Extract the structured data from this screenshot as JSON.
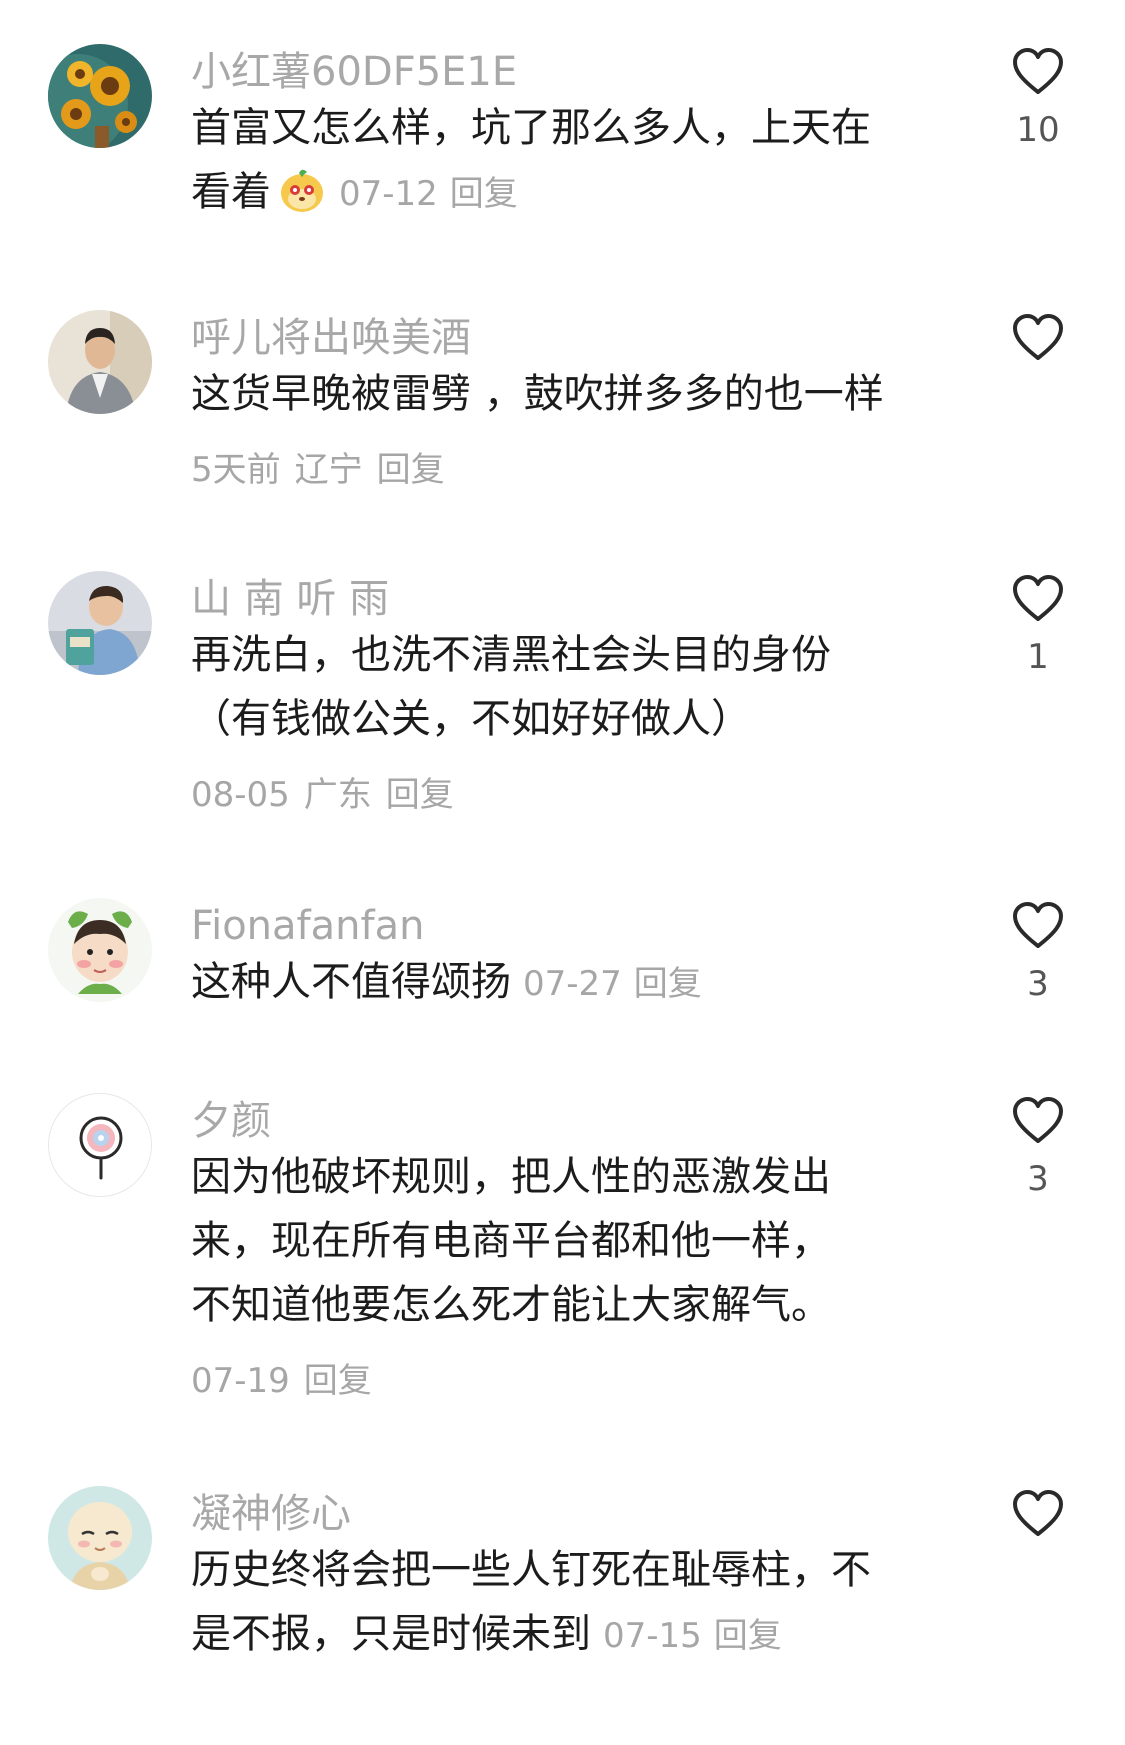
{
  "comments": [
    {
      "username": "小红薯60DF5E1E",
      "text": "首富又怎么样，坑了那么多人，上天在看着",
      "has_emoji": true,
      "date": "07-12",
      "location": "",
      "reply_label": "回复",
      "likes": "10",
      "avatar": "sunflower-painting"
    },
    {
      "username": "呼儿将出唤美酒",
      "text": "这货早晚被雷劈 ，鼓吹拼多多的也一样",
      "date": "5天前",
      "location": "辽宁",
      "reply_label": "回复",
      "likes": "",
      "avatar": "man-in-suit-photo"
    },
    {
      "username": "山 南 听 雨",
      "text": "再洗白，也洗不清黑社会头目的身份（有钱做公关，不如好好做人）",
      "date": "08-05",
      "location": "广东",
      "reply_label": "回复",
      "likes": "1",
      "avatar": "child-photo"
    },
    {
      "username": "Fionafanfan",
      "text": "这种人不值得颂扬",
      "date": "07-27",
      "location": "",
      "reply_label": "回复",
      "likes": "3",
      "avatar": "baby-cartoon"
    },
    {
      "username": "夕颜",
      "text": "因为他破坏规则，把人性的恶激发出来，现在所有电商平台都和他一样，不知道他要怎么死才能让大家解气。",
      "date": "07-19",
      "location": "",
      "reply_label": "回复",
      "likes": "3",
      "avatar": "lollipop-icon"
    },
    {
      "username": "凝神修心",
      "text": "历史终将会把一些人钉死在耻辱柱，不是不报，只是时候未到",
      "date": "07-15",
      "location": "",
      "reply_label": "回复",
      "likes": "",
      "avatar": "monk-cartoon"
    }
  ],
  "icons": {
    "like": "heart-outline-icon",
    "emoji": "cute-face-emoji"
  },
  "colors": {
    "username": "#a8a8a8",
    "text": "#1c1c1c",
    "meta": "#a6a6a6",
    "like_count": "#555555"
  }
}
